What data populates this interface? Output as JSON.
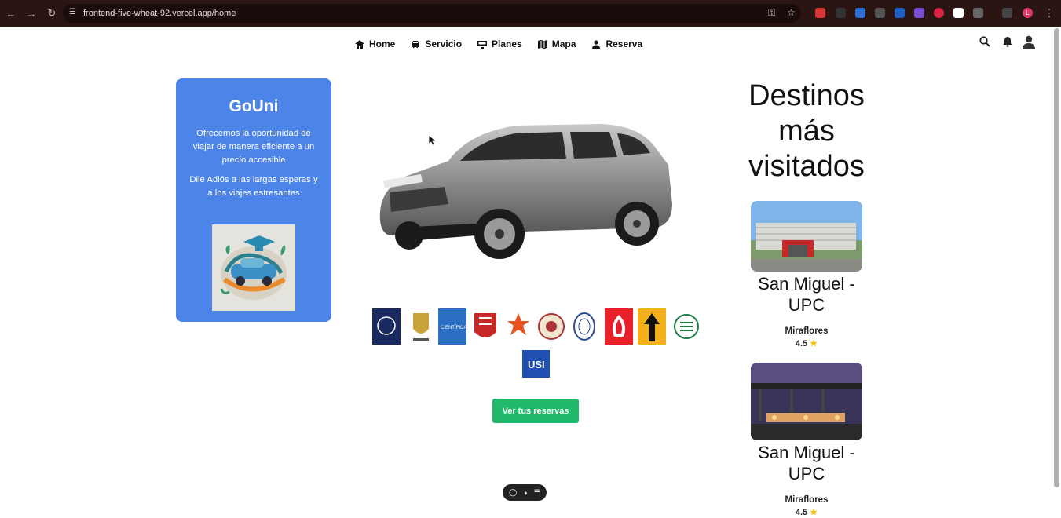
{
  "browser": {
    "url": "frontend-five-wheat-92.vercel.app/home",
    "profile_initial": "L"
  },
  "nav": {
    "items": [
      {
        "label": "Home",
        "icon": "home-icon"
      },
      {
        "label": "Servicio",
        "icon": "car-icon"
      },
      {
        "label": "Planes",
        "icon": "monitor-icon"
      },
      {
        "label": "Mapa",
        "icon": "map-icon"
      },
      {
        "label": "Reserva",
        "icon": "person-icon"
      }
    ]
  },
  "hero_card": {
    "title": "GoUni",
    "text1": "Ofrecemos la oportunidad de viajar de manera eficiente a un precio accesible",
    "text2": "Dile Adiós a las largas esperas y a los viajes estresantes"
  },
  "cta": {
    "label": "Ver tus reservas"
  },
  "destinations": {
    "title": "Destinos más visitados",
    "items": [
      {
        "name": "San Miguel - UPC",
        "location": "Miraflores",
        "rating": "4.5"
      },
      {
        "name": "San Miguel - UPC",
        "location": "Miraflores",
        "rating": "4.5"
      }
    ]
  },
  "colors": {
    "card": "#4c84e8",
    "cta": "#21b96a",
    "star": "#f5c518"
  }
}
